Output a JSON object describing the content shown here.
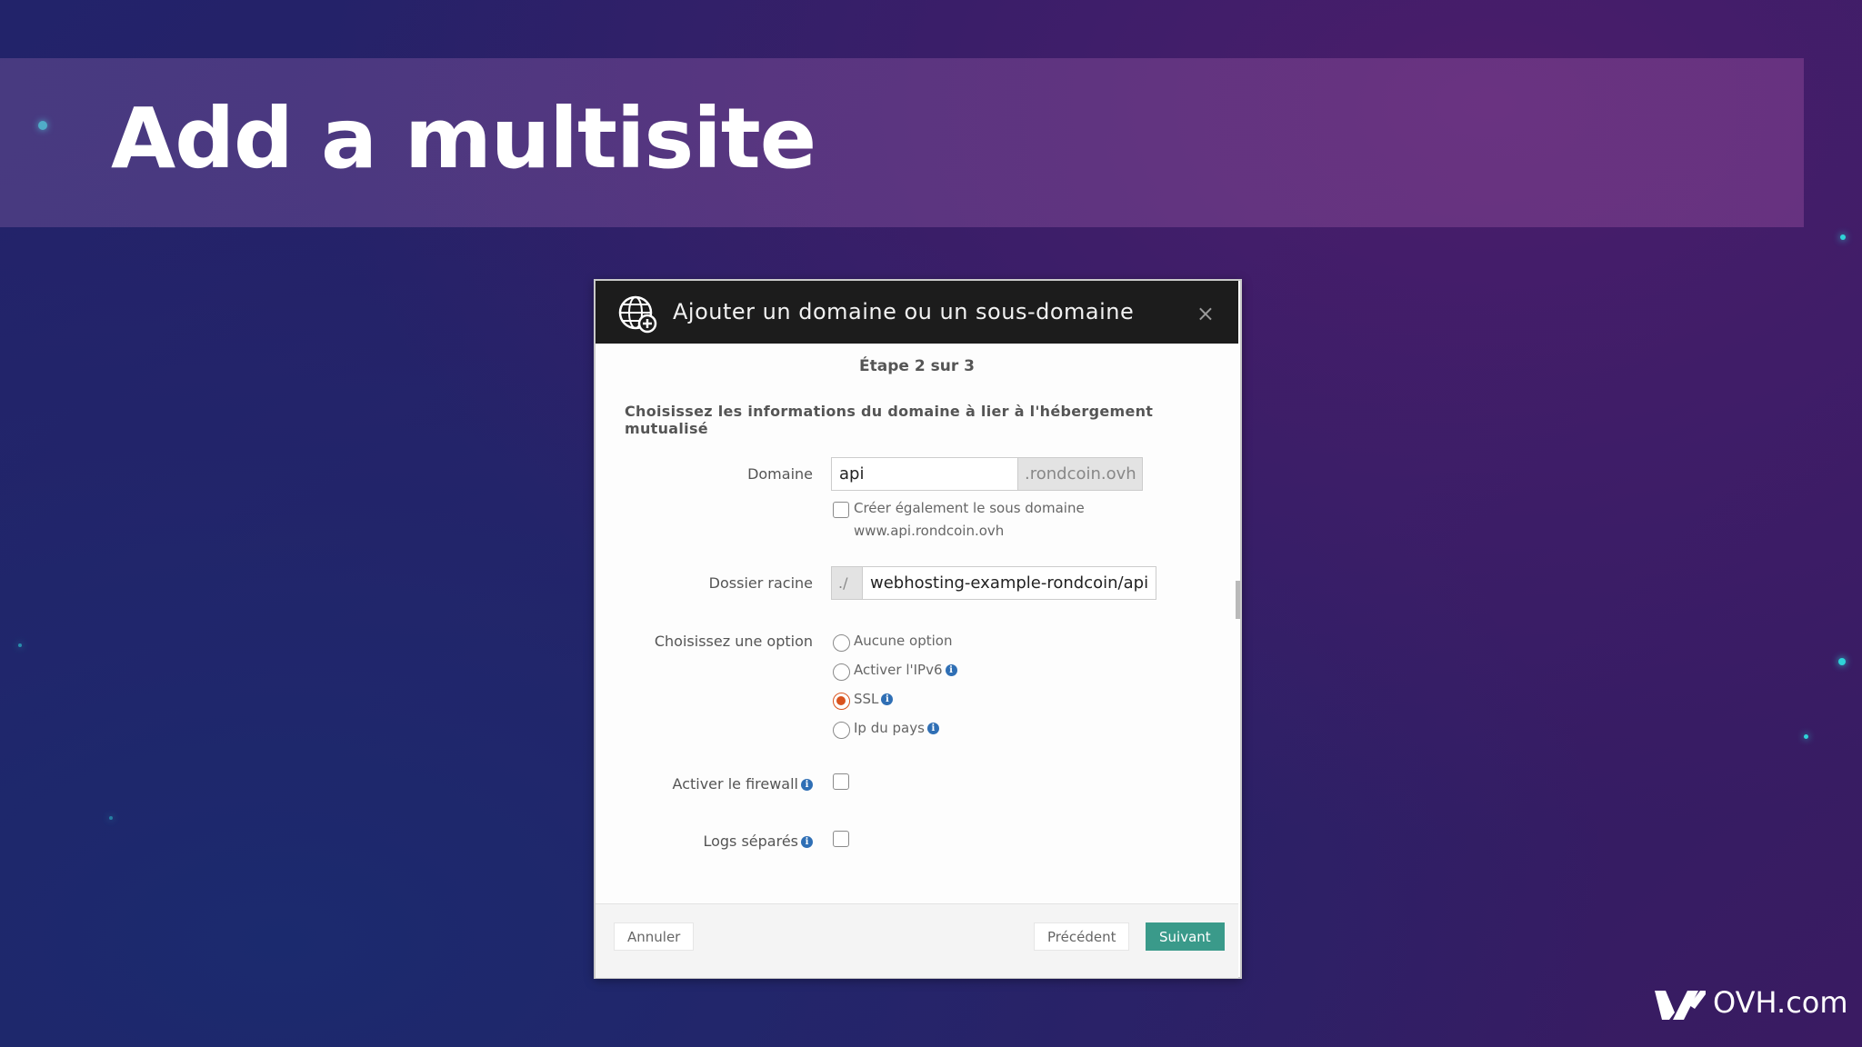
{
  "slide": {
    "title": "Add a multisite"
  },
  "modal": {
    "title": "Ajouter un domaine ou un sous-domaine",
    "close_symbol": "×",
    "step": "Étape 2 sur 3",
    "intro": "Choisissez les informations du domaine à lier à l'hébergement mutualisé",
    "domain": {
      "label": "Domaine",
      "value": "api",
      "suffix": ".rondcoin.ovh",
      "www_checkbox_line1": "Créer également le sous domaine",
      "www_checkbox_line2": "www.api.rondcoin.ovh",
      "www_checked": false
    },
    "root_folder": {
      "label": "Dossier racine",
      "prefix": "./",
      "value": "webhosting-example-rondcoin/api"
    },
    "option": {
      "label": "Choisissez une option",
      "choices": [
        {
          "label": "Aucune option",
          "info": false,
          "selected": false
        },
        {
          "label": "Activer l'IPv6",
          "info": true,
          "selected": false
        },
        {
          "label": "SSL",
          "info": true,
          "selected": true
        },
        {
          "label": "Ip du pays",
          "info": true,
          "selected": false
        }
      ]
    },
    "firewall": {
      "label": "Activer le firewall",
      "checked": false
    },
    "logs": {
      "label": "Logs séparés",
      "checked": false
    },
    "buttons": {
      "cancel": "Annuler",
      "previous": "Précédent",
      "next": "Suivant"
    }
  },
  "brand": {
    "logo_text": "OVH.com"
  },
  "icons": {
    "header": "globe-add-icon",
    "info": "info-icon",
    "close": "close-icon",
    "logo": "ovh-logo-icon"
  },
  "colors": {
    "accent_selected": "#d9531e",
    "primary_button": "#3a9a8a",
    "info": "#2f6fb5",
    "header_bg": "#1c1c1c"
  }
}
